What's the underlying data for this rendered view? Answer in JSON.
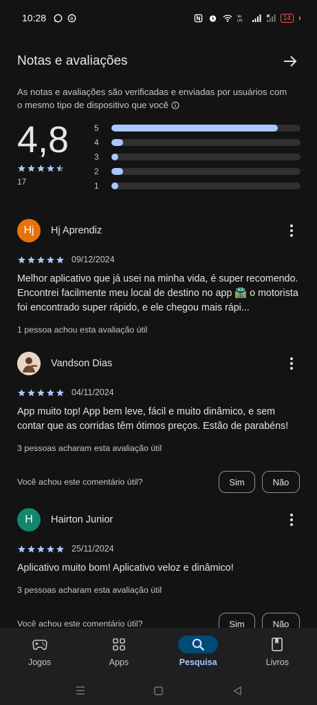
{
  "status": {
    "time": "10:28",
    "battery": "14"
  },
  "header": {
    "title": "Notas e avaliações",
    "verified_text": "As notas e avaliações são verificadas e enviadas por usuários com o mesmo tipo de dispositivo que você"
  },
  "summary": {
    "rating": "4,8",
    "stars": 4.5,
    "count": "17",
    "bars": [
      {
        "label": "5",
        "fraction": 0.88
      },
      {
        "label": "4",
        "fraction": 0.06
      },
      {
        "label": "3",
        "fraction": 0.03
      },
      {
        "label": "2",
        "fraction": 0.06
      },
      {
        "label": "1",
        "fraction": 0.03
      }
    ]
  },
  "reviews": [
    {
      "initials": "Hj",
      "avatar_color": "#e8710a",
      "name": "Hj Aprendiz",
      "stars": 5,
      "date": "09/12/2024",
      "body": "Melhor aplicativo que já usei na minha vida, é super recomendo. Encontrei facilmente meu local de destino no app 🛣️ o motorista foi encontrado super rápido, e ele chegou mais rápi...",
      "helpful": "1 pessoa achou esta avaliação útil"
    },
    {
      "initials": "",
      "avatar_color": "#d9c3b0",
      "name": "Vandson Dias",
      "stars": 5,
      "date": "04/11/2024",
      "body": "App muito top! App bem leve, fácil e muito dinâmico, e sem contar que as corridas têm ótimos preços. Estão de parabéns!",
      "helpful": "3 pessoas acharam esta avaliação útil"
    },
    {
      "initials": "H",
      "avatar_color": "#12866f",
      "name": "Hairton Junior",
      "stars": 5,
      "date": "25/11/2024",
      "body": "Aplicativo muito bom! Aplicativo veloz e dinâmico!",
      "helpful": "3 pessoas acharam esta avaliação útil"
    }
  ],
  "feedback": {
    "question": "Você achou este comentário útil?",
    "yes": "Sim",
    "no": "Não"
  },
  "nav": {
    "items": [
      {
        "label": "Jogos",
        "icon": "gamepad-icon"
      },
      {
        "label": "Apps",
        "icon": "apps-grid-icon"
      },
      {
        "label": "Pesquisa",
        "icon": "search-icon",
        "active": true
      },
      {
        "label": "Livros",
        "icon": "bookmark-book-icon"
      }
    ]
  },
  "colors": {
    "accent": "#a8c7fa",
    "star": "#a8c7fa",
    "active_nav_bg": "#004a77",
    "background": "#131313"
  }
}
